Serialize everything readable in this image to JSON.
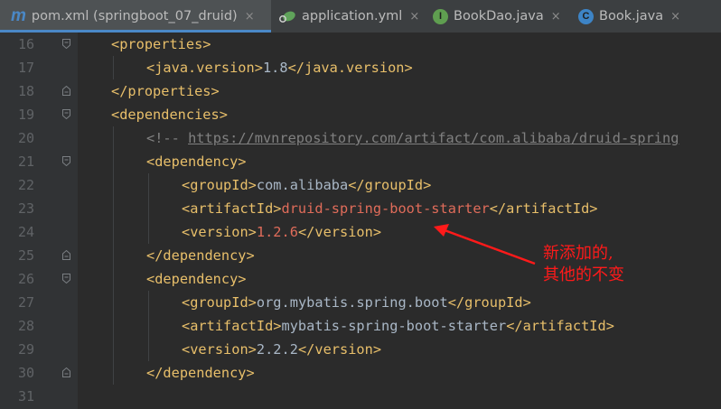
{
  "tabs": [
    {
      "label": "pom.xml (springboot_07_druid)",
      "icon": "maven-icon"
    },
    {
      "label": "application.yml",
      "icon": "spring-leaf-icon"
    },
    {
      "label": "BookDao.java",
      "icon": "interface-icon"
    },
    {
      "label": "Book.java",
      "icon": "class-icon"
    }
  ],
  "tab_close": "×",
  "icon_glyphs": {
    "maven": "m",
    "interface": "I",
    "class": "C"
  },
  "colors": {
    "tag": "#e8bf6a",
    "text": "#a9b7c6",
    "changed": "#e06c5a",
    "comment": "#808080",
    "annotation": "#ff1a1a",
    "tab_underline": "#4a88c7"
  },
  "code_lines": [
    {
      "num": "16",
      "indent": 0,
      "parts": [
        {
          "t": "<properties>",
          "c": "t"
        }
      ]
    },
    {
      "num": "17",
      "indent": 1,
      "parts": [
        {
          "t": "<java.version>",
          "c": "t"
        },
        {
          "t": "1.8",
          "c": "x"
        },
        {
          "t": "</java.version>",
          "c": "t"
        }
      ]
    },
    {
      "num": "18",
      "indent": 0,
      "parts": [
        {
          "t": "</properties>",
          "c": "t"
        }
      ]
    },
    {
      "num": "19",
      "indent": 0,
      "parts": [
        {
          "t": "<dependencies>",
          "c": "t"
        }
      ]
    },
    {
      "num": "20",
      "indent": 1,
      "parts": [
        {
          "t": "<!-- ",
          "c": "cm"
        },
        {
          "t": "https://mvnrepository.com/artifact/com.alibaba/druid-spring",
          "c": "url"
        }
      ]
    },
    {
      "num": "21",
      "indent": 1,
      "parts": [
        {
          "t": "<dependency>",
          "c": "t"
        }
      ]
    },
    {
      "num": "22",
      "indent": 2,
      "parts": [
        {
          "t": "<groupId>",
          "c": "t"
        },
        {
          "t": "com.alibaba",
          "c": "x"
        },
        {
          "t": "</groupId>",
          "c": "t"
        }
      ]
    },
    {
      "num": "23",
      "indent": 2,
      "parts": [
        {
          "t": "<artifactId>",
          "c": "t"
        },
        {
          "t": "druid-spring-boot-starter",
          "c": "r"
        },
        {
          "t": "</artifactId>",
          "c": "t"
        }
      ]
    },
    {
      "num": "24",
      "indent": 2,
      "parts": [
        {
          "t": "<version>",
          "c": "t"
        },
        {
          "t": "1.2.6",
          "c": "r"
        },
        {
          "t": "</version>",
          "c": "t"
        }
      ]
    },
    {
      "num": "25",
      "indent": 1,
      "parts": [
        {
          "t": "</dependency>",
          "c": "t"
        }
      ]
    },
    {
      "num": "26",
      "indent": 1,
      "parts": [
        {
          "t": "<dependency>",
          "c": "t"
        }
      ]
    },
    {
      "num": "27",
      "indent": 2,
      "parts": [
        {
          "t": "<groupId>",
          "c": "t"
        },
        {
          "t": "org.mybatis.spring.boot",
          "c": "x"
        },
        {
          "t": "</groupId>",
          "c": "t"
        }
      ]
    },
    {
      "num": "28",
      "indent": 2,
      "parts": [
        {
          "t": "<artifactId>",
          "c": "t"
        },
        {
          "t": "mybatis-spring-boot-starter",
          "c": "x"
        },
        {
          "t": "</artifactId>",
          "c": "t"
        }
      ]
    },
    {
      "num": "29",
      "indent": 2,
      "parts": [
        {
          "t": "<version>",
          "c": "t"
        },
        {
          "t": "2.2.2",
          "c": "x"
        },
        {
          "t": "</version>",
          "c": "t"
        }
      ]
    },
    {
      "num": "30",
      "indent": 1,
      "parts": [
        {
          "t": "</dependency>",
          "c": "t"
        }
      ]
    },
    {
      "num": "31",
      "indent": 0,
      "parts": []
    }
  ],
  "fold_markers": {
    "16": "open",
    "18": "close",
    "19": "open",
    "21": "open",
    "25": "close",
    "26": "open",
    "30": "close"
  },
  "annotation": {
    "line1": "新添加的,",
    "line2": "其他的不变"
  }
}
